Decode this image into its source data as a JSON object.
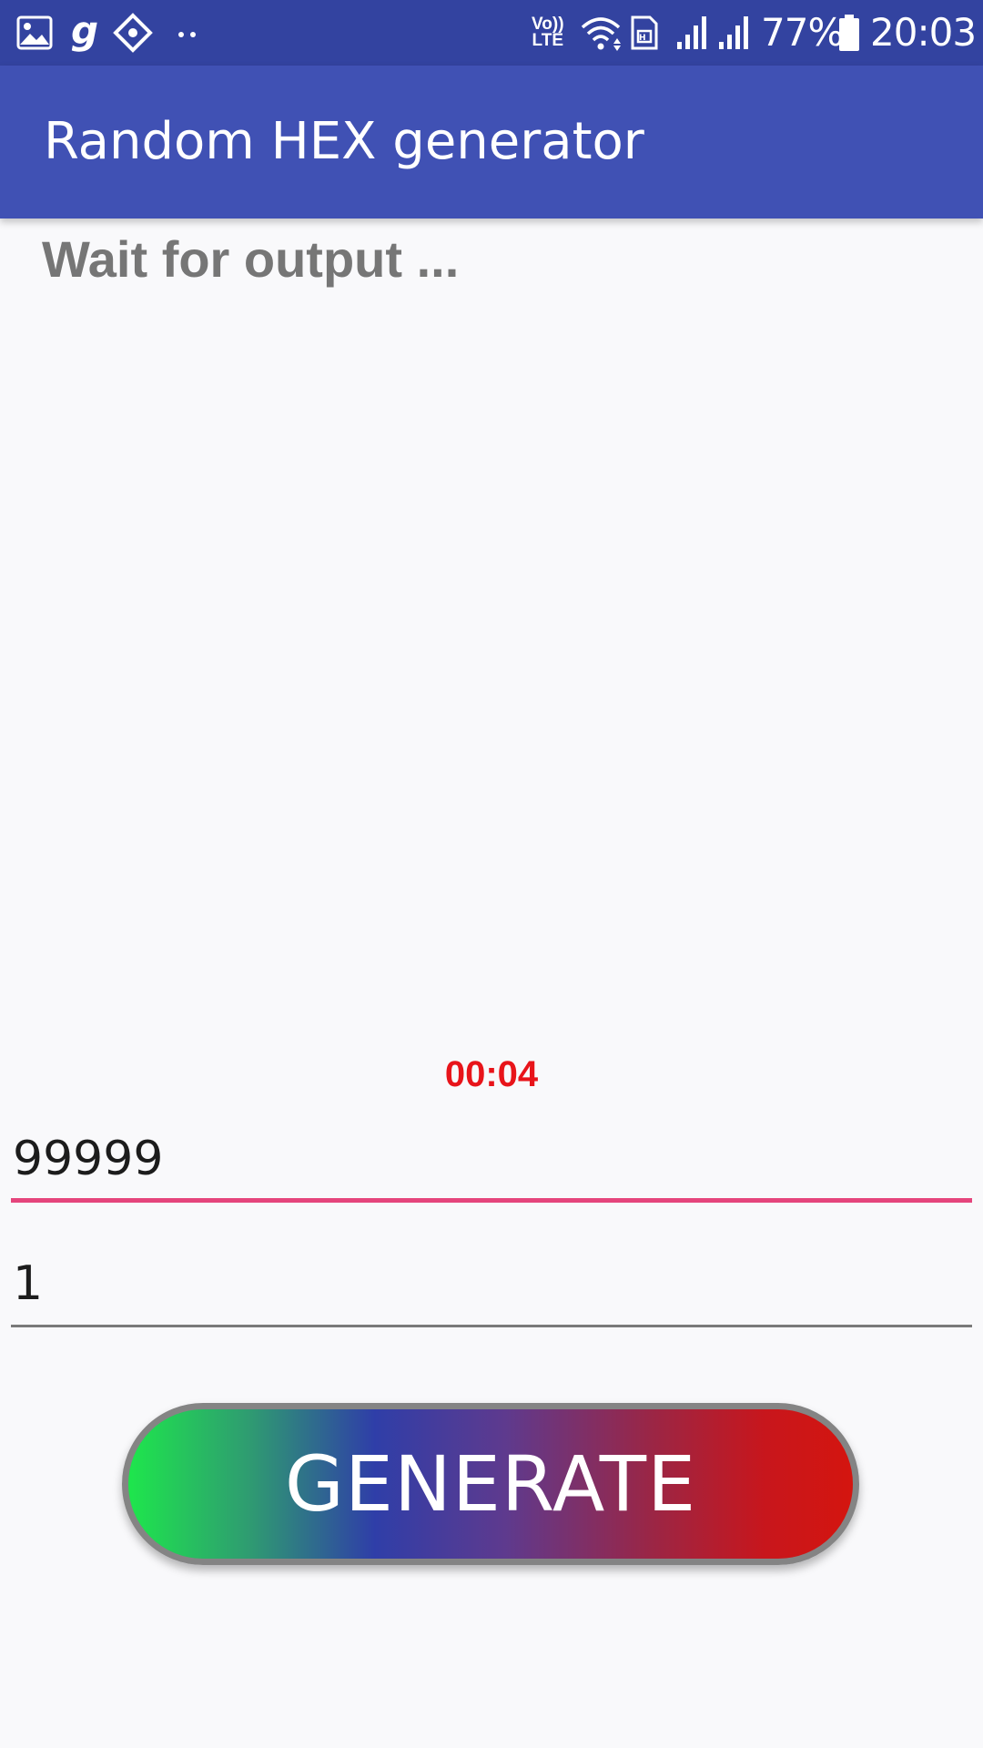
{
  "status_bar": {
    "left_icons": [
      "gallery-icon",
      "g-app-icon",
      "navigation-diamond-icon",
      "more-dots-icon"
    ],
    "right_icons": [
      "volte-icon",
      "wifi-icon",
      "sim-icon",
      "signal-1-icon",
      "signal-2-icon",
      "battery-icon"
    ],
    "volte_line1": "Vo))",
    "volte_line2": "LTE",
    "battery_percent": "77%",
    "time": "20:03"
  },
  "app_bar": {
    "title": "Random HEX generator",
    "background_color": "#4051b4"
  },
  "main": {
    "output_text": "Wait for output  ...",
    "timer": "00:04",
    "timer_color": "#e8141a",
    "input_max": {
      "value": "99999",
      "placeholder": ""
    },
    "input_count": {
      "value": "1",
      "placeholder": ""
    },
    "generate_button": {
      "label": "GENERATE"
    },
    "accent_color": "#e5457c"
  }
}
